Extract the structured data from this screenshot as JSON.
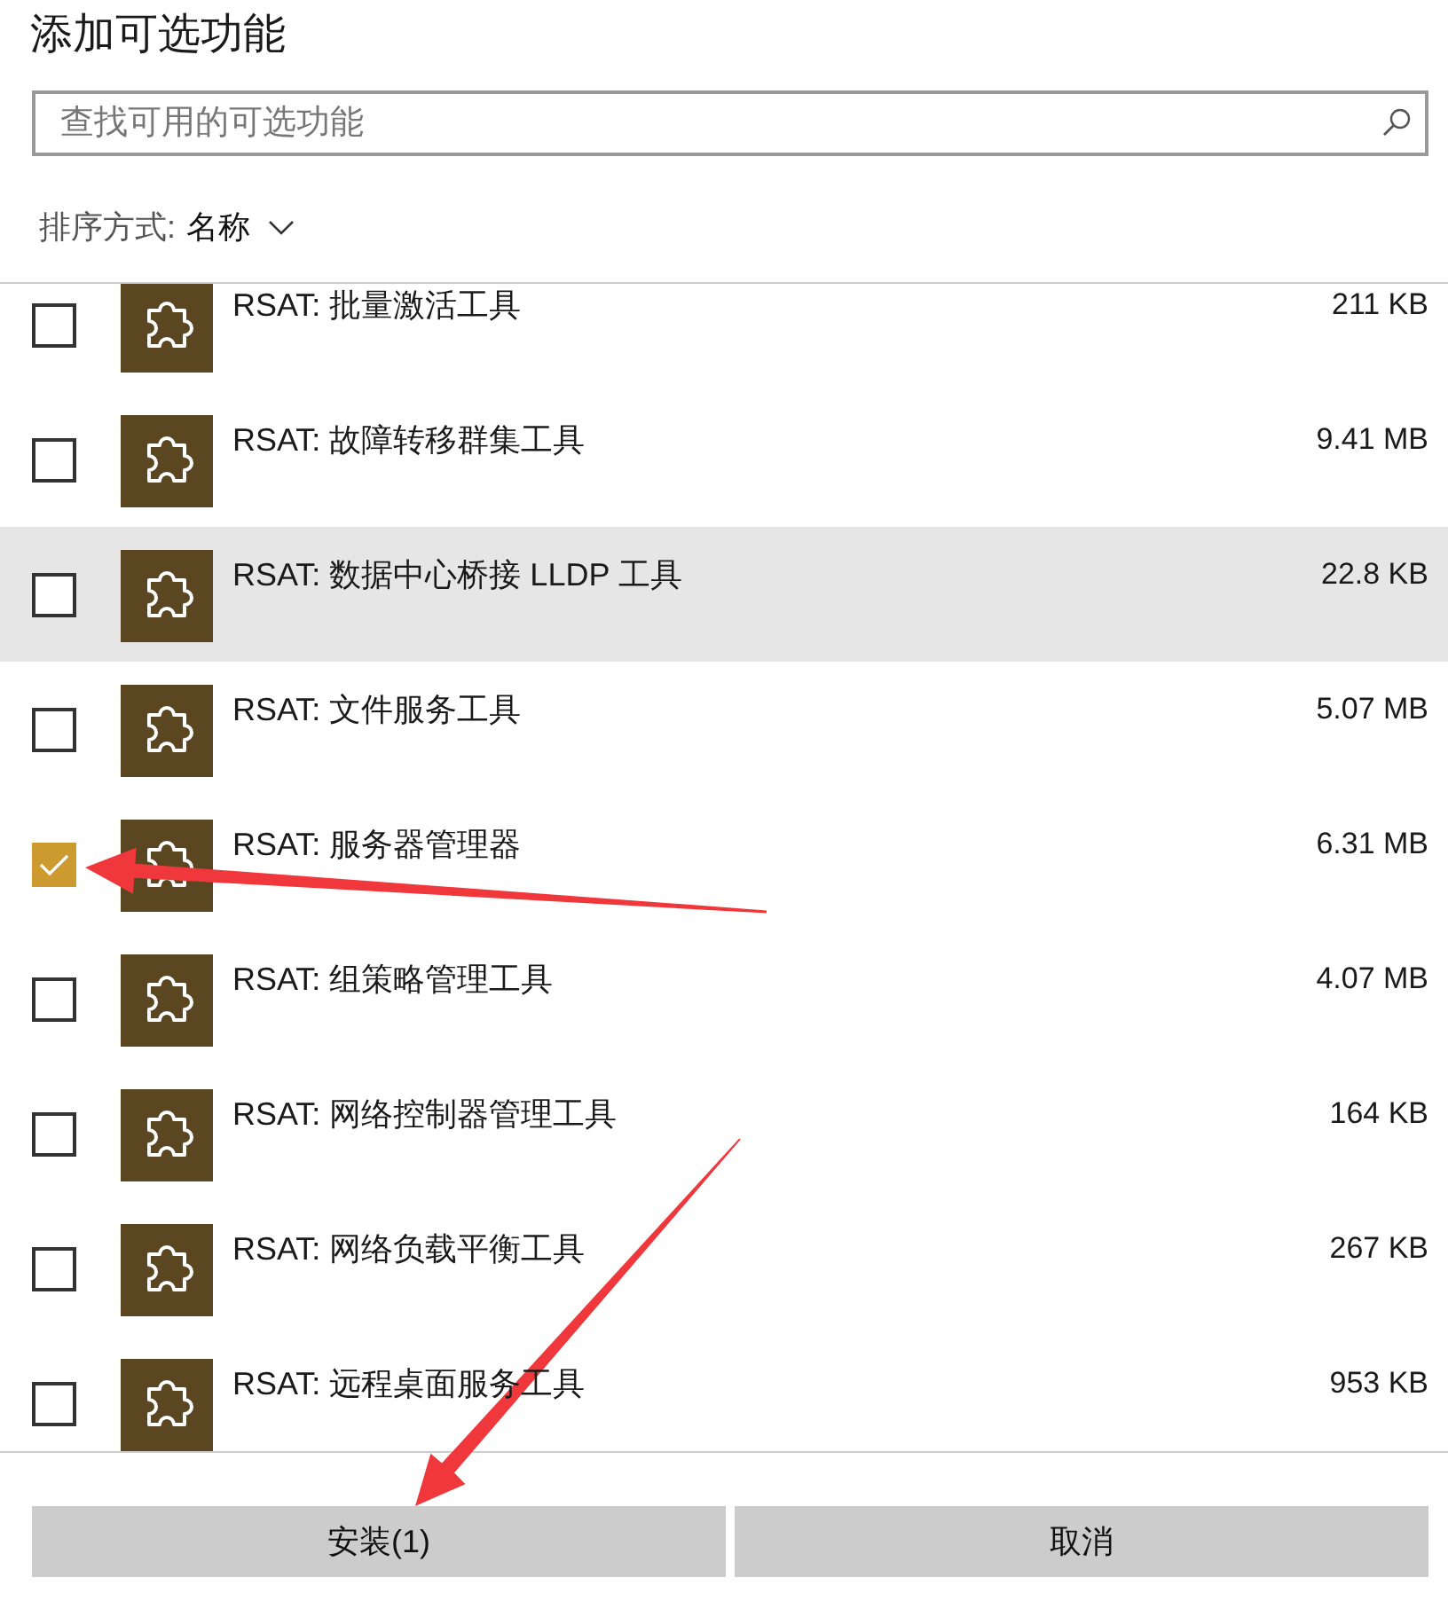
{
  "title": "添加可选功能",
  "search": {
    "placeholder": "查找可用的可选功能"
  },
  "sort": {
    "label": "排序方式:",
    "value": "名称"
  },
  "features": [
    {
      "name": "RSAT: 批量激活工具",
      "size": "211 KB",
      "checked": false,
      "highlighted": false
    },
    {
      "name": "RSAT: 故障转移群集工具",
      "size": "9.41 MB",
      "checked": false,
      "highlighted": false
    },
    {
      "name": "RSAT: 数据中心桥接 LLDP 工具",
      "size": "22.8 KB",
      "checked": false,
      "highlighted": true
    },
    {
      "name": "RSAT: 文件服务工具",
      "size": "5.07 MB",
      "checked": false,
      "highlighted": false
    },
    {
      "name": "RSAT: 服务器管理器",
      "size": "6.31 MB",
      "checked": true,
      "highlighted": false
    },
    {
      "name": "RSAT: 组策略管理工具",
      "size": "4.07 MB",
      "checked": false,
      "highlighted": false
    },
    {
      "name": "RSAT: 网络控制器管理工具",
      "size": "164 KB",
      "checked": false,
      "highlighted": false
    },
    {
      "name": "RSAT: 网络负载平衡工具",
      "size": "267 KB",
      "checked": false,
      "highlighted": false
    },
    {
      "name": "RSAT: 远程桌面服务工具",
      "size": "953 KB",
      "checked": false,
      "highlighted": false
    }
  ],
  "buttons": [
    "安装(1)",
    "取消"
  ]
}
